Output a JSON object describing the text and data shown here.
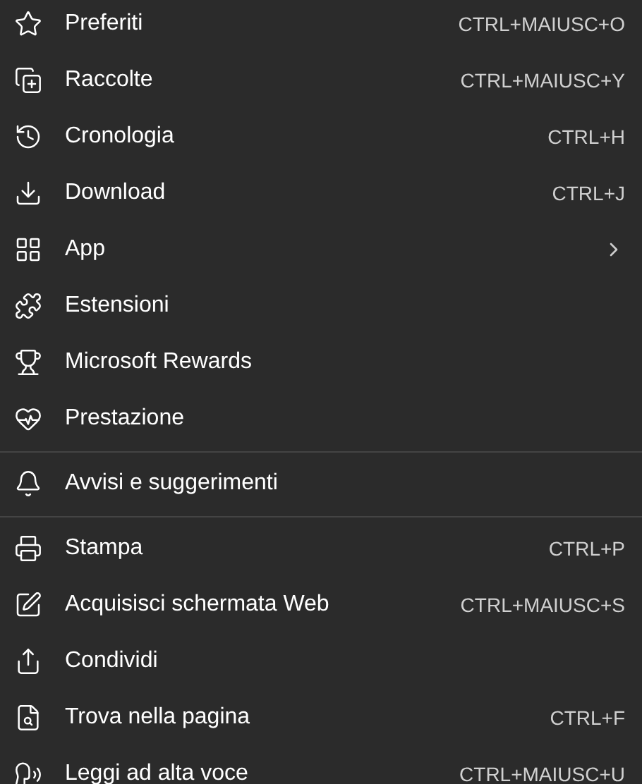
{
  "sections": [
    {
      "items": [
        {
          "label": "Preferiti",
          "shortcut": "CTRL+MAIUSC+O",
          "submenu": false
        },
        {
          "label": "Raccolte",
          "shortcut": "CTRL+MAIUSC+Y",
          "submenu": false
        },
        {
          "label": "Cronologia",
          "shortcut": "CTRL+H",
          "submenu": false
        },
        {
          "label": "Download",
          "shortcut": "CTRL+J",
          "submenu": false
        },
        {
          "label": "App",
          "submenu": true
        },
        {
          "label": "Estensioni",
          "submenu": false
        },
        {
          "label": "Microsoft Rewards",
          "submenu": false
        },
        {
          "label": "Prestazione",
          "submenu": false
        }
      ]
    },
    {
      "items": [
        {
          "label": "Avvisi e suggerimenti",
          "submenu": false
        }
      ]
    },
    {
      "items": [
        {
          "label": "Stampa",
          "shortcut": "CTRL+P",
          "submenu": false
        },
        {
          "label": "Acquisisci schermata Web",
          "shortcut": "CTRL+MAIUSC+S",
          "submenu": false
        },
        {
          "label": "Condividi",
          "submenu": false
        },
        {
          "label": "Trova nella pagina",
          "shortcut": "CTRL+F",
          "submenu": false
        },
        {
          "label": "Leggi ad alta voce",
          "shortcut": "CTRL+MAIUSC+U",
          "submenu": false
        }
      ]
    }
  ]
}
